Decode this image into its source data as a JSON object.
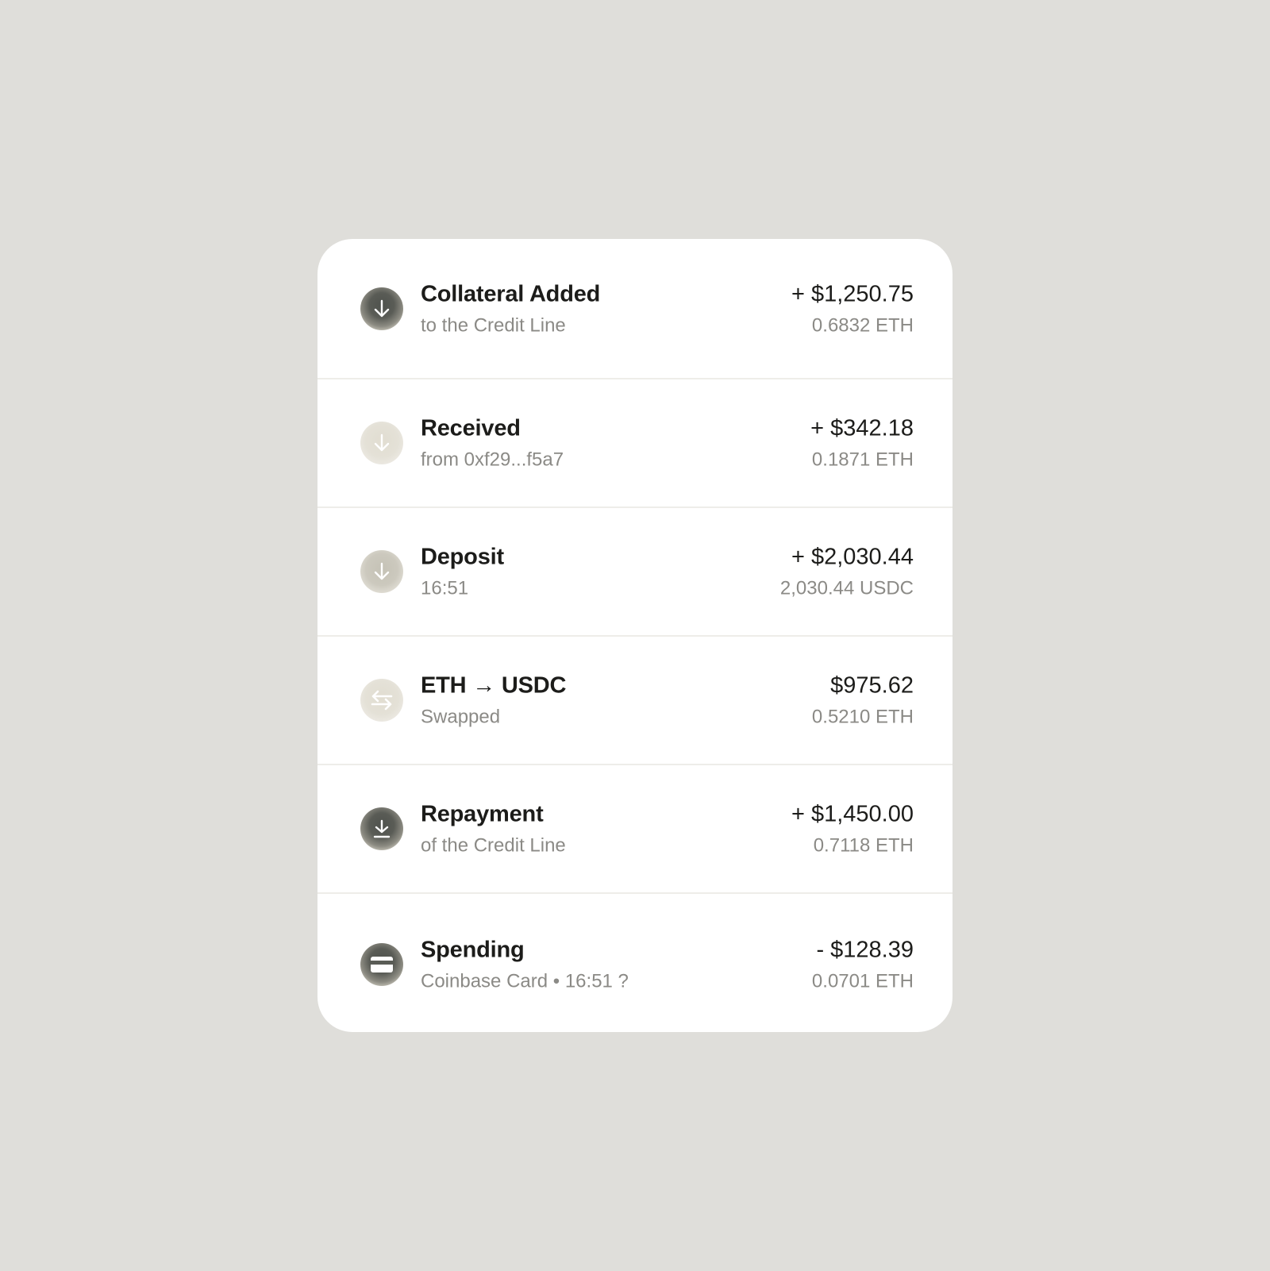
{
  "transactions": [
    {
      "icon": "arrow-down-icon",
      "title": "Collateral Added",
      "subtitle": "to the Credit Line",
      "amount": "+ $1,250.75",
      "crypto": "0.6832 ETH"
    },
    {
      "icon": "arrow-down-icon",
      "title": "Received",
      "subtitle": "from 0xf29...f5a7",
      "amount": "+ $342.18",
      "crypto": "0.1871 ETH"
    },
    {
      "icon": "arrow-down-icon",
      "title": "Deposit",
      "subtitle": "16:51",
      "amount": "+ $2,030.44",
      "crypto": "2,030.44 USDC"
    },
    {
      "icon": "swap-arrows-icon",
      "title": "ETH → USDC",
      "subtitle": "Swapped",
      "amount": "$975.62",
      "crypto": "0.5210 ETH"
    },
    {
      "icon": "download-icon",
      "title": "Repayment",
      "subtitle": "of the Credit Line",
      "amount": "+ $1,450.00",
      "crypto": "0.7118 ETH"
    },
    {
      "icon": "credit-card-icon",
      "title": "Spending",
      "subtitle": "Coinbase Card • 16:51 ?",
      "amount": "- $128.39",
      "crypto": "0.0701 ETH"
    }
  ]
}
